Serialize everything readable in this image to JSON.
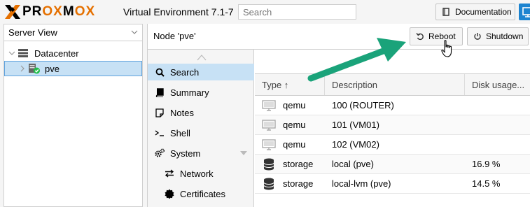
{
  "header": {
    "logo_text_left": "PR",
    "logo_text_ox": "OX",
    "logo_text_m": "M",
    "logo_text_ox2": "OX",
    "version": "Virtual Environment 7.1-7",
    "search_placeholder": "Search",
    "documentation_label": "Documentation"
  },
  "tree": {
    "view_label": "Server View",
    "datacenter_label": "Datacenter",
    "node_label": "pve"
  },
  "main": {
    "node_title": "Node 'pve'",
    "reboot_label": "Reboot",
    "shutdown_label": "Shutdown"
  },
  "nav": {
    "items": [
      {
        "label": "Search",
        "icon": "search-icon"
      },
      {
        "label": "Summary",
        "icon": "book-icon"
      },
      {
        "label": "Notes",
        "icon": "note-icon"
      },
      {
        "label": "Shell",
        "icon": "terminal-icon"
      },
      {
        "label": "System",
        "icon": "gears-icon"
      },
      {
        "label": "Network",
        "icon": "exchange-icon"
      },
      {
        "label": "Certificates",
        "icon": "certificate-icon"
      }
    ]
  },
  "grid": {
    "columns": [
      "Type ↑",
      "Description",
      "Disk usage..."
    ],
    "rows": [
      {
        "type": "qemu",
        "description": "100 (ROUTER)",
        "disk": ""
      },
      {
        "type": "qemu",
        "description": "101 (VM01)",
        "disk": ""
      },
      {
        "type": "qemu",
        "description": "102 (VM02)",
        "disk": ""
      },
      {
        "type": "storage",
        "description": "local (pve)",
        "disk": "16.9 %"
      },
      {
        "type": "storage",
        "description": "local-lvm (pve)",
        "disk": "14.5 %"
      }
    ]
  },
  "colors": {
    "brand_orange": "#e57000",
    "selection_blue": "#c7e1f5",
    "arrow_green": "#1aa37a",
    "accent_blue": "#1d84d0"
  }
}
